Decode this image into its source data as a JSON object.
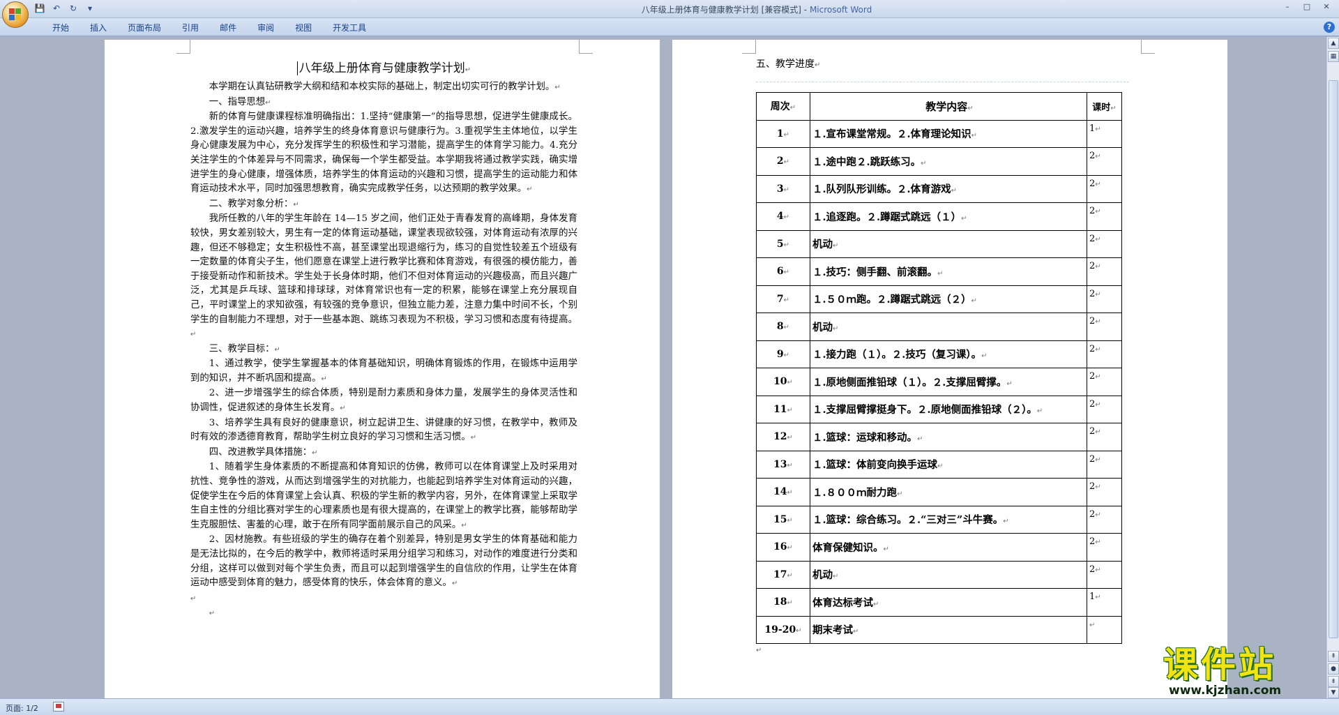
{
  "window": {
    "title": "八年级上册体育与健康教学计划 [兼容模式]",
    "title_sep": " - ",
    "app_name": "Microsoft Word",
    "controls": [
      "–",
      "□",
      "✕"
    ]
  },
  "quick_access": {
    "save_icon": "💾",
    "undo_icon": "↶",
    "redo_icon": "↻",
    "dropdown_icon": "▾"
  },
  "ribbon": {
    "tabs": [
      "开始",
      "插入",
      "页面布局",
      "引用",
      "邮件",
      "审阅",
      "视图",
      "开发工具"
    ],
    "help": "?"
  },
  "page1": {
    "title": "八年级上册体育与健康教学计划",
    "paragraphs": [
      {
        "text": "本学期在认真钻研教学大纲和结和本校实际的基础上，制定出切实可行的教学计划。",
        "indent": "ind2"
      },
      {
        "text": "一、指导思想",
        "indent": "ind2"
      },
      {
        "text": "新的体育与健康课程标准明确指出：1.坚持“健康第一”的指导思想，促进学生健康成长。2.激发学生的运动兴趣，培养学生的终身体育意识与健康行为。3.重视学生主体地位，以学生身心健康发展为中心，充分发挥学生的积极性和学习潜能，提高学生的体育学习能力。4.充分关注学生的个体差异与不同需求，确保每一个学生都受益。本学期我将通过教学实践，确实增进学生的身心健康，增强体质，培养学生的体育运动的兴趣和习惯，提高学生的运动能力和体育运动技术水平，同时加强思想教育，确实完成教学任务，以达预期的教学效果。",
        "indent": "ind2"
      },
      {
        "text": "二、教学对象分析：",
        "indent": "ind2"
      },
      {
        "text": "我所任教的八年的学生年龄在 14—15 岁之间，他们正处于青春发育的高峰期，身体发育较快，男女差别较大，男生有一定的体育运动基础，课堂表现欲较强，对体育运动有浓厚的兴趣，但还不够稳定；女生积极性不高，甚至课堂出现退缩行为，练习的自觉性较差五个班级有一定数量的体育尖子生，他们愿意在课堂上进行教学比赛和体育游戏，有很强的模仿能力，善于接受新动作和新技术。学生处于长身体时期，他们不但对体育运动的兴趣极高，而且兴趣广泛，尤其是乒乓球、篮球和排球球，对体育常识也有一定的积累，能够在课堂上充分展现自己，平时课堂上的求知欲强，有较强的竞争意识，但独立能力差，注意力集中时间不长，个别学生的自制能力不理想，对于一些基本跑、跳练习表现为不积极，学习习惯和态度有待提高。",
        "indent": "ind2"
      },
      {
        "text": "三、教学目标：",
        "indent": "ind2"
      },
      {
        "text": "1、通过教学，使学生掌握基本的体育基础知识，明确体育锻炼的作用，在锻炼中运用学到的知识，并不断巩固和提高。",
        "indent": "ind2"
      },
      {
        "text": "2、进一步增强学生的综合体质，特别是耐力素质和身体力量，发展学生的身体灵活性和协调性，促进叙述的身体生长发育。",
        "indent": "ind2"
      },
      {
        "text": "3、培养学生具有良好的健康意识，树立起讲卫生、讲健康的好习惯，在教学中，教师及时有效的渗透德育教育，帮助学生树立良好的学习习惯和生活习惯。",
        "indent": "ind2"
      },
      {
        "text": "四、改进教学具体措施：",
        "indent": "ind2"
      },
      {
        "text": "1、随着学生身体素质的不断提高和体育知识的仿佛，教师可以在体育课堂上及时采用对抗性、竞争性的游戏，从而达到增强学生的对抗能力，也能起到培养学生对体育运动的兴趣，促使学生在今后的体育课堂上会认真、积极的学生新的教学内容，另外，在体育课堂上采取学生自主性的分组比赛对学生的心理素质也是有很大提高的，在课堂上的教学比赛，能够帮助学生克服胆怯、害羞的心理，敢于在所有同学面前展示自己的风采。",
        "indent": "ind2"
      },
      {
        "text": "2、因材施教。有些班级的学生的确存在着个别差异，特别是男女学生的体育基础和能力是无法比拟的，在今后的教学中，教师将适时采用分组学习和练习，对动作的难度进行分类和分组，这样可以做到对每个学生负责，而且可以起到增强学生的自信欣的作用，让学生在体育运动中感受到体育的魅力，感受体育的快乐，体会体育的意义。",
        "indent": "ind2"
      },
      {
        "text": "",
        "indent": ""
      },
      {
        "text": "",
        "indent": "ind2"
      }
    ],
    "para_mark": "↵"
  },
  "page2": {
    "heading": "五、教学进度",
    "table": {
      "headers": [
        "周次",
        "教学内容",
        "课时"
      ],
      "rows": [
        {
          "week": "1",
          "content": "１.宣布课堂常规。２.体育理论知识",
          "hours": "1"
        },
        {
          "week": "2",
          "content": "１.途中跑２.跳跃练习。",
          "hours": "2"
        },
        {
          "week": "3",
          "content": "１.队列队形训练。２.体育游戏",
          "hours": "2"
        },
        {
          "week": "4",
          "content": "１.追逐跑。２.蹲踞式跳远（１）",
          "hours": "2"
        },
        {
          "week": "5",
          "content": "机动",
          "hours": "2"
        },
        {
          "week": "6",
          "content": "１.技巧：侧手翻、前滚翻。",
          "hours": "2"
        },
        {
          "week": "7",
          "content": "１.５０ｍ跑。２.蹲踞式跳远（２）",
          "hours": "2"
        },
        {
          "week": "8",
          "content": "机动",
          "hours": "2"
        },
        {
          "week": "9",
          "content": "１.接力跑（１）。２.技巧（复习课）。",
          "hours": "2"
        },
        {
          "week": "10",
          "content": "１.原地侧面推铅球（１）。２.支撑屈臂撑。",
          "hours": "2"
        },
        {
          "week": "11",
          "content": "１.支撑屈臂撑挺身下。２.原地侧面推铅球（２）。",
          "hours": "2"
        },
        {
          "week": "12",
          "content": "１.篮球：运球和移动。",
          "hours": "2"
        },
        {
          "week": "13",
          "content": "１.篮球：体前变向换手运球",
          "hours": "2"
        },
        {
          "week": "14",
          "content": "１.８００ｍ耐力跑",
          "hours": "2"
        },
        {
          "week": "15",
          "content": "１.篮球：综合练习。２.“三对三”斗牛赛。",
          "hours": "2"
        },
        {
          "week": "16",
          "content": "体育保健知识。",
          "hours": "2"
        },
        {
          "week": "17",
          "content": "机动",
          "hours": "2"
        },
        {
          "week": "18",
          "content": "体育达标考试",
          "hours": "1"
        },
        {
          "week": "19-20",
          "content": "期末考试",
          "hours": ""
        }
      ]
    },
    "cell_mark": "↵",
    "end_marks": [
      "↵",
      "↵"
    ]
  },
  "statusbar": {
    "page_count": "页面: 1/2"
  },
  "watermark": {
    "text": "课件站",
    "url": "www.kjzhan.com"
  },
  "colors": {
    "title_app": "#3f64a8",
    "ribbon_text": "#15428b",
    "watermark_fill": "#f2e312",
    "watermark_outline": "#1d6b1b"
  }
}
